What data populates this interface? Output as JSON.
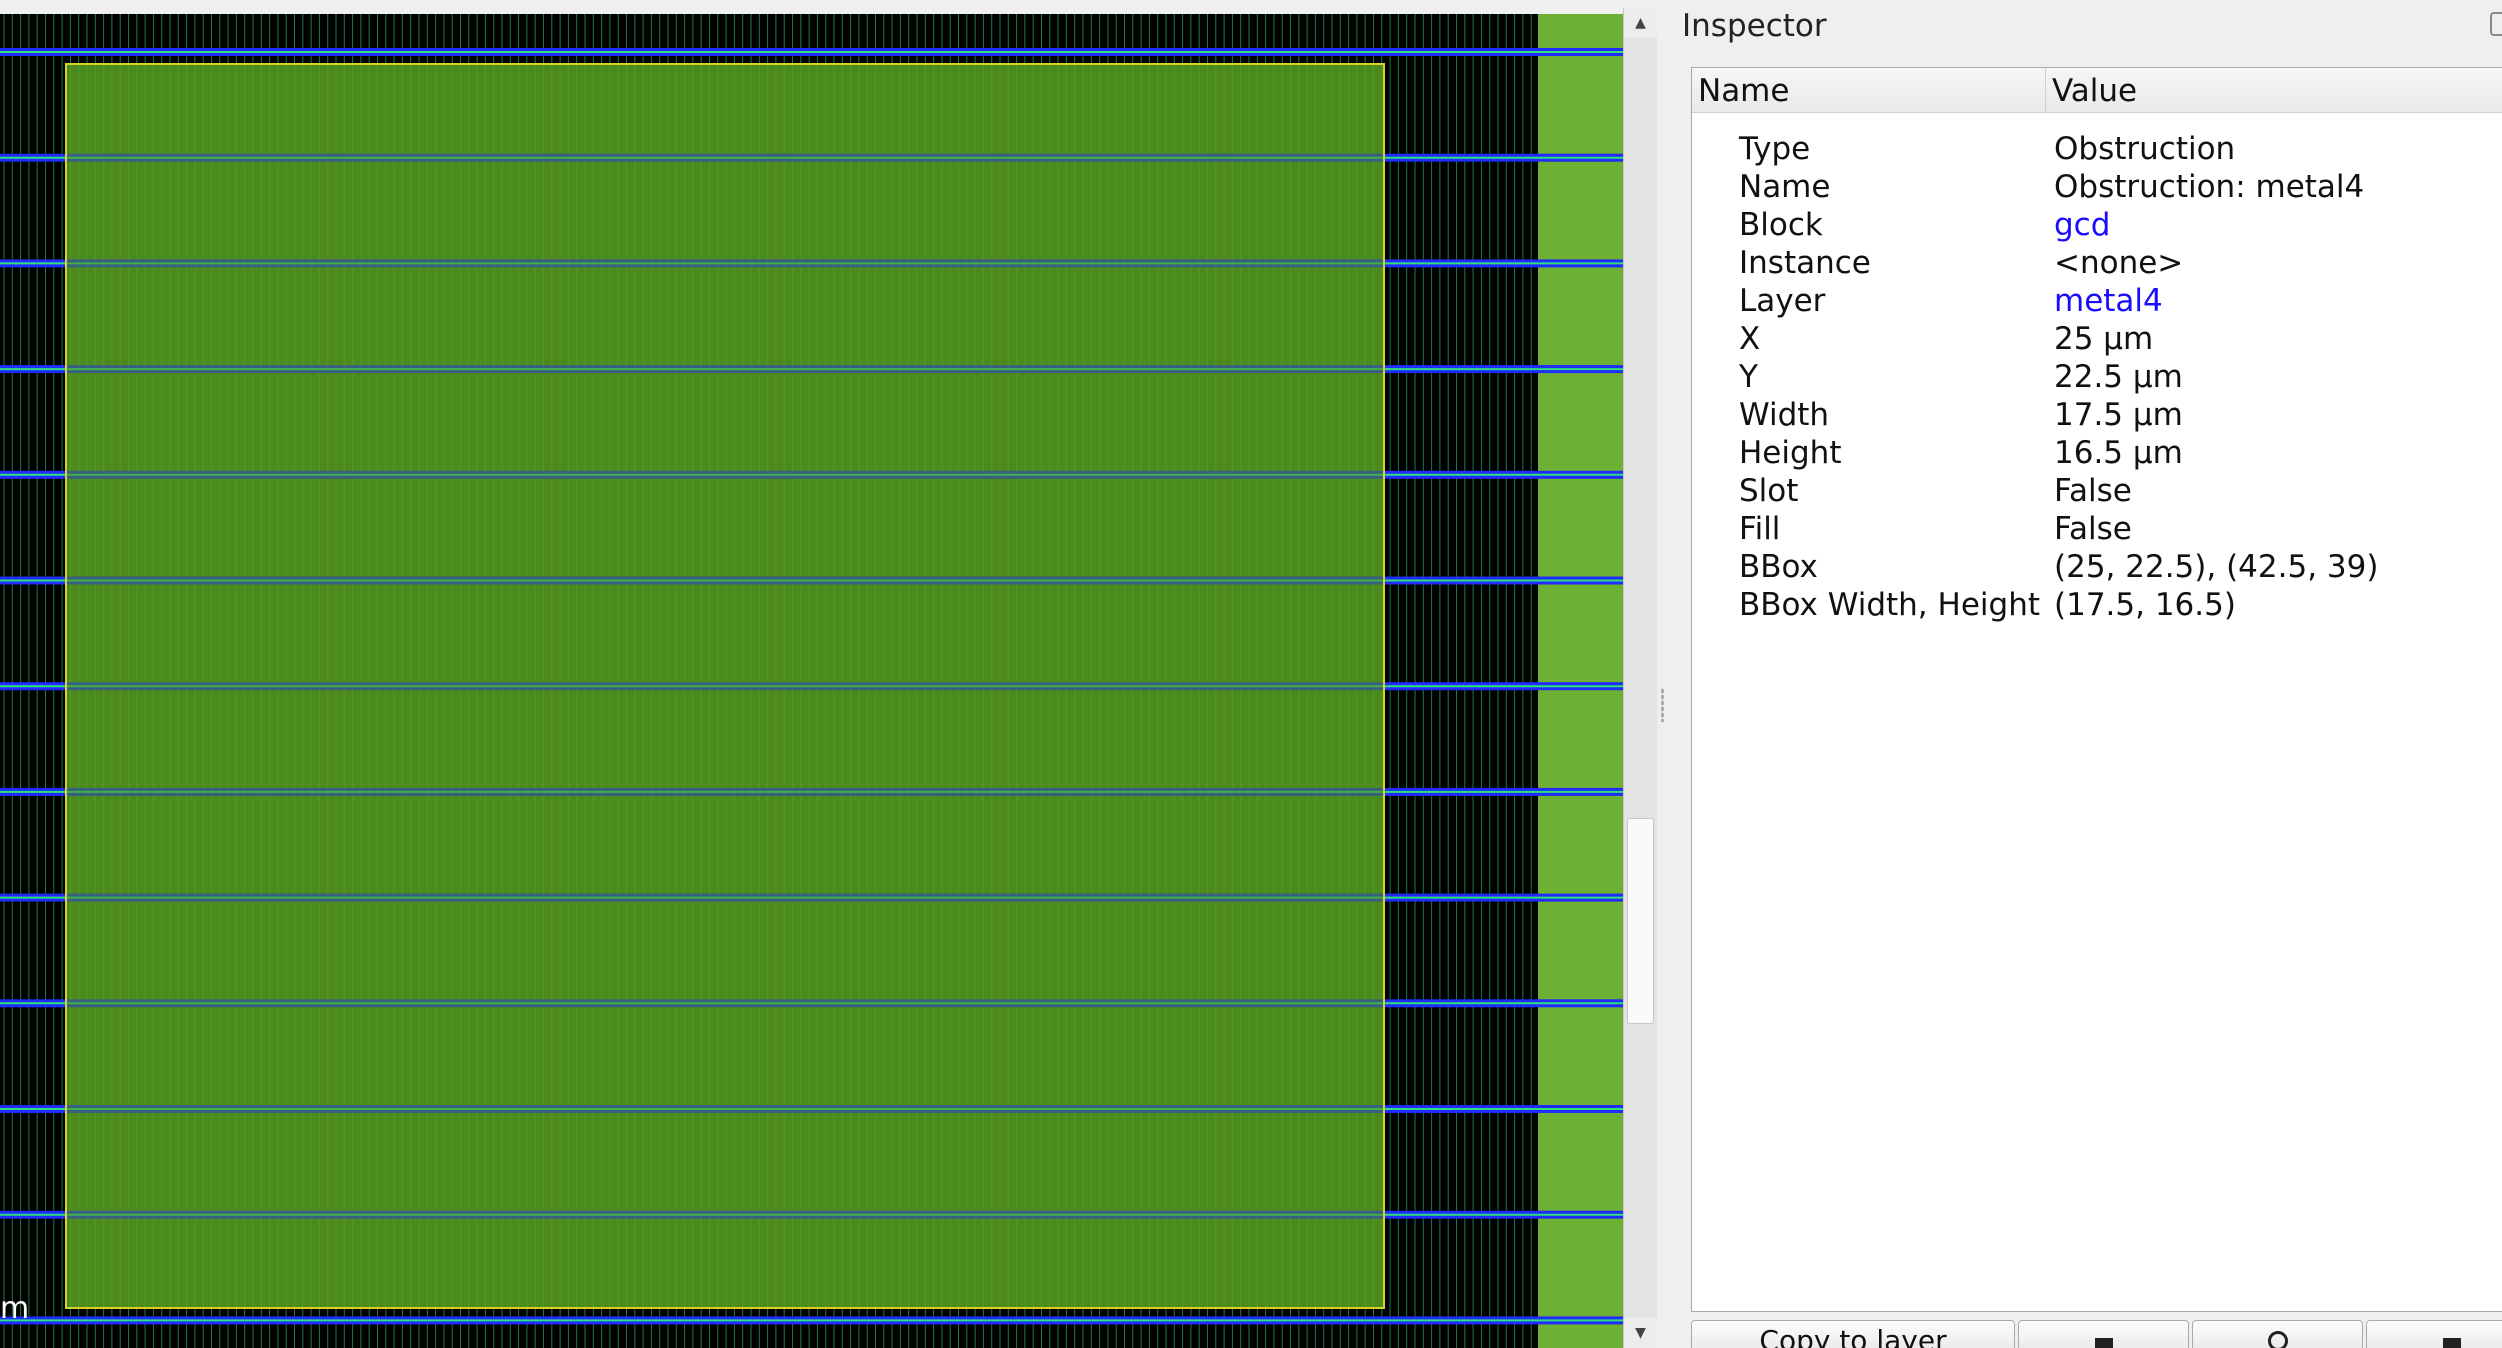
{
  "layout_view": {
    "scale_text": "m",
    "colors": {
      "background": "#000000",
      "track_blue": "#1f2bff",
      "track_green": "#2ee07a",
      "obstruction_fill": "#4f8a1b",
      "obstruction_border": "#d8d22a",
      "right_strip": "#6db033"
    }
  },
  "scrollbar": {
    "up_icon": "▲",
    "down_icon": "▼"
  },
  "inspector": {
    "title": "Inspector",
    "table": {
      "header_name": "Name",
      "header_value": "Value",
      "rows": [
        {
          "name": "Type",
          "value": "Obstruction",
          "link": false
        },
        {
          "name": "Name",
          "value": "Obstruction: metal4",
          "link": false
        },
        {
          "name": "Block",
          "value": "gcd",
          "link": true
        },
        {
          "name": "Instance",
          "value": "<none>",
          "link": false
        },
        {
          "name": "Layer",
          "value": "metal4",
          "link": true
        },
        {
          "name": "X",
          "value": "25 μm",
          "link": false
        },
        {
          "name": "Y",
          "value": "22.5 μm",
          "link": false
        },
        {
          "name": "Width",
          "value": "17.5 μm",
          "link": false
        },
        {
          "name": "Height",
          "value": "16.5 μm",
          "link": false
        },
        {
          "name": "Slot",
          "value": "False",
          "link": false
        },
        {
          "name": "Fill",
          "value": "False",
          "link": false
        },
        {
          "name": "BBox",
          "value": "(25, 22.5), (42.5, 39)",
          "link": false
        },
        {
          "name": "BBox Width, Height",
          "value": "(17.5, 16.5)",
          "link": false
        }
      ]
    },
    "buttons": {
      "copy_to_layer": "Copy to layer",
      "icons": [
        "trash-icon",
        "zoom-to-icon",
        "filter-icon"
      ]
    }
  }
}
